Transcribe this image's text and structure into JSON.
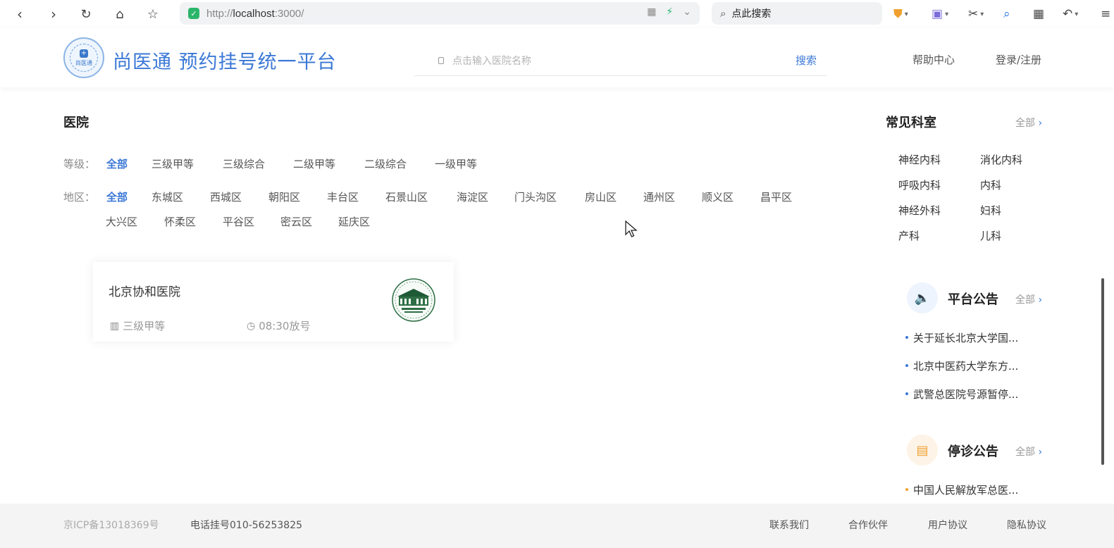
{
  "browser": {
    "url_prefix": "http://",
    "url_host": "localhost",
    "url_suffix": ":3000/",
    "search_placeholder": "点此搜索"
  },
  "header": {
    "logo_text": "尚医通",
    "title": "尚医通 预约挂号统一平台",
    "search_placeholder": "点击输入医院名称",
    "search_button": "搜索",
    "help": "帮助中心",
    "login": "登录/注册"
  },
  "hospital_section": {
    "title": "医院",
    "level_label": "等级：",
    "levels": [
      "全部",
      "三级甲等",
      "三级综合",
      "二级甲等",
      "二级综合",
      "一级甲等"
    ],
    "region_label": "地区：",
    "regions": [
      "全部",
      "东城区",
      "西城区",
      "朝阳区",
      "丰台区",
      "石景山区",
      "海淀区",
      "门头沟区",
      "房山区",
      "通州区",
      "顺义区",
      "昌平区",
      "大兴区",
      "怀柔区",
      "平谷区",
      "密云区",
      "延庆区"
    ],
    "cards": [
      {
        "name": "北京协和医院",
        "level": "三级甲等",
        "release_time": "08:30放号"
      }
    ]
  },
  "departments": {
    "title": "常见科室",
    "more": "全部",
    "items": [
      "神经内科",
      "消化内科",
      "呼吸内科",
      "内科",
      "神经外科",
      "妇科",
      "产科",
      "儿科"
    ]
  },
  "platform_notice": {
    "title": "平台公告",
    "more": "全部",
    "accent": "#3b78d6",
    "items": [
      "关于延长北京大学国...",
      "北京中医药大学东方...",
      "武警总医院号源暂停..."
    ]
  },
  "suspension_notice": {
    "title": "停诊公告",
    "more": "全部",
    "accent": "#f0a030",
    "items": [
      "中国人民解放军总医..."
    ]
  },
  "footer": {
    "icp": "京ICP备13018369号",
    "phone": "电话挂号010-56253825",
    "links": [
      "联系我们",
      "合作伙伴",
      "用户协议",
      "隐私协议"
    ]
  },
  "colors": {
    "primary": "#3b78d6",
    "orange": "#f0a030"
  }
}
